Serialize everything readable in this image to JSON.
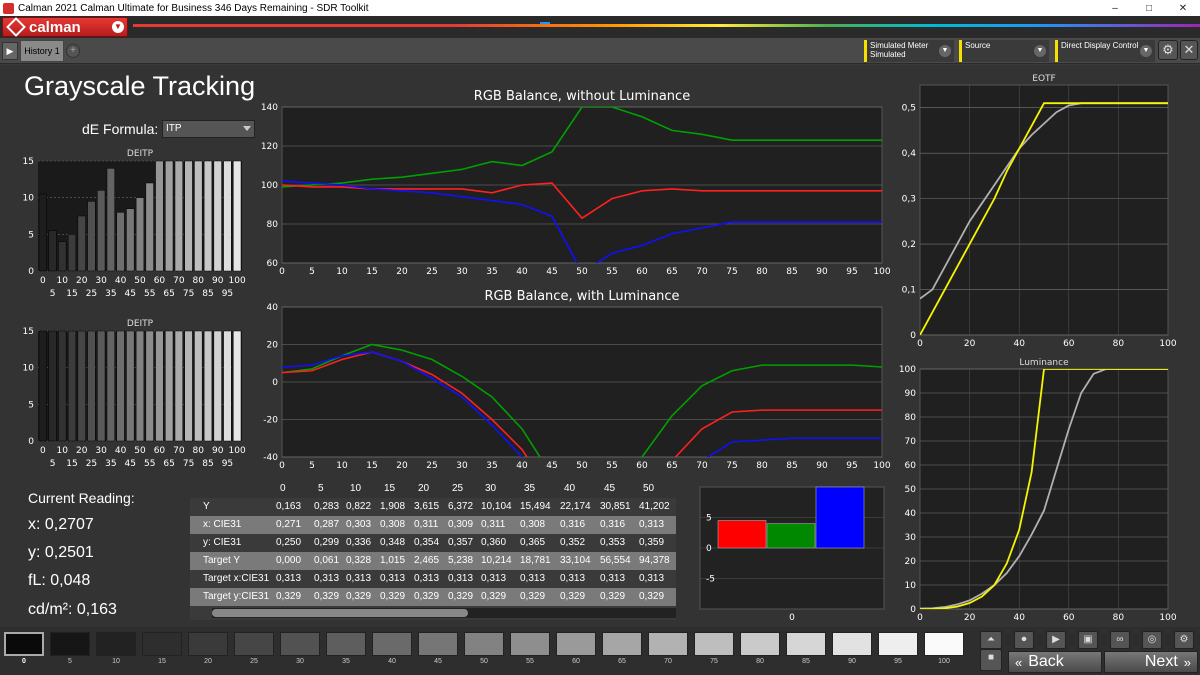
{
  "window": {
    "title": "Calman 2021 Calman Ultimate for Business 346 Days Remaining  - SDR Toolkit",
    "minimize": "–",
    "maximize": "□",
    "close": "✕"
  },
  "brand": {
    "logo_text": "calman"
  },
  "tabs": {
    "history": "History 1",
    "add": "+"
  },
  "dropdowns": {
    "meter_label": "Simulated Meter",
    "meter_value": "Simulated",
    "source_label": "Source",
    "display_label": "Direct Display Control"
  },
  "page": {
    "title": "Grayscale Tracking",
    "de_formula_label": "dE Formula:",
    "de_formula_value": "ITP"
  },
  "current_reading": {
    "heading": "Current Reading:",
    "x": "x: 0,2707",
    "y": "y: 0,2501",
    "fl": "fL: 0,048",
    "cdm2": "cd/m²: 0,163"
  },
  "table": {
    "columns": [
      "0",
      "5",
      "10",
      "15",
      "20",
      "25",
      "30",
      "35",
      "40",
      "45",
      "50"
    ],
    "rows": [
      {
        "label": "Y",
        "values": [
          "0,163",
          "0,283",
          "0,822",
          "1,908",
          "3,615",
          "6,372",
          "10,104",
          "15,494",
          "22,174",
          "30,851",
          "41,202"
        ]
      },
      {
        "label": "x: CIE31",
        "values": [
          "0,271",
          "0,287",
          "0,303",
          "0,308",
          "0,311",
          "0,309",
          "0,311",
          "0,308",
          "0,316",
          "0,316",
          "0,313"
        ]
      },
      {
        "label": "y: CIE31",
        "values": [
          "0,250",
          "0,299",
          "0,336",
          "0,348",
          "0,354",
          "0,357",
          "0,360",
          "0,365",
          "0,352",
          "0,353",
          "0,359"
        ]
      },
      {
        "label": "Target Y",
        "values": [
          "0,000",
          "0,061",
          "0,328",
          "1,015",
          "2,465",
          "5,238",
          "10,214",
          "18,781",
          "33,104",
          "56,554",
          "94,378"
        ]
      },
      {
        "label": "Target x:CIE31",
        "values": [
          "0,313",
          "0,313",
          "0,313",
          "0,313",
          "0,313",
          "0,313",
          "0,313",
          "0,313",
          "0,313",
          "0,313",
          "0,313"
        ]
      },
      {
        "label": "Target y:CIE31",
        "values": [
          "0,329",
          "0,329",
          "0,329",
          "0,329",
          "0,329",
          "0,329",
          "0,329",
          "0,329",
          "0,329",
          "0,329",
          "0,329"
        ]
      }
    ]
  },
  "patches": {
    "labels": [
      "0",
      "5",
      "10",
      "15",
      "20",
      "25",
      "30",
      "35",
      "40",
      "45",
      "50",
      "55",
      "60",
      "65",
      "70",
      "75",
      "80",
      "85",
      "90",
      "95",
      "100"
    ]
  },
  "nav": {
    "back": "Back",
    "next": "Next"
  },
  "colors": {
    "accent_yellow": "#f5e000",
    "brand_red": "#d32f2f"
  },
  "chart_data": [
    {
      "type": "bar",
      "title": "DEITP",
      "categories": [
        "0",
        "5",
        "10",
        "15",
        "20",
        "25",
        "30",
        "35",
        "40",
        "45",
        "50",
        "55",
        "60",
        "65",
        "70",
        "75",
        "80",
        "85",
        "90",
        "95",
        "100"
      ],
      "values": [
        10.5,
        5.5,
        4,
        5,
        7.5,
        9.5,
        11,
        14,
        8,
        8.5,
        10,
        12,
        15,
        15,
        15,
        15,
        15,
        15,
        15,
        15,
        15
      ],
      "ylim": [
        0,
        15
      ],
      "yticks": [
        0,
        5,
        10,
        15
      ],
      "xticks_row1": [
        "0",
        "10",
        "20",
        "30",
        "40",
        "50",
        "60",
        "70",
        "80",
        "90",
        "100"
      ],
      "xticks_row2": [
        "5",
        "15",
        "25",
        "35",
        "45",
        "55",
        "65",
        "75",
        "85",
        "95"
      ]
    },
    {
      "type": "bar",
      "title": "DEITP",
      "categories": [
        "0",
        "5",
        "10",
        "15",
        "20",
        "25",
        "30",
        "35",
        "40",
        "45",
        "50",
        "55",
        "60",
        "65",
        "70",
        "75",
        "80",
        "85",
        "90",
        "95",
        "100"
      ],
      "values": [
        15,
        15,
        15,
        15,
        15,
        15,
        15,
        15,
        15,
        15,
        15,
        15,
        15,
        15,
        15,
        15,
        15,
        15,
        15,
        15,
        15
      ],
      "ylim": [
        0,
        15
      ],
      "yticks": [
        0,
        5,
        10,
        15
      ],
      "xticks_row1": [
        "0",
        "10",
        "20",
        "30",
        "40",
        "50",
        "60",
        "70",
        "80",
        "90",
        "100"
      ],
      "xticks_row2": [
        "5",
        "15",
        "25",
        "35",
        "45",
        "55",
        "65",
        "75",
        "85",
        "95"
      ]
    },
    {
      "type": "line",
      "title": "RGB Balance, without Luminance",
      "x": [
        0,
        5,
        10,
        15,
        20,
        25,
        30,
        35,
        40,
        45,
        50,
        55,
        60,
        65,
        70,
        75,
        80,
        85,
        90,
        95,
        100
      ],
      "ylim": [
        60,
        140
      ],
      "yticks": [
        60,
        80,
        100,
        120,
        140
      ],
      "xticks": [
        0,
        5,
        10,
        15,
        20,
        25,
        30,
        35,
        40,
        45,
        50,
        55,
        60,
        65,
        70,
        75,
        80,
        85,
        90,
        95,
        100
      ],
      "series": [
        {
          "color": "#00a000",
          "values": [
            99,
            100,
            101,
            103,
            104,
            106,
            108,
            112,
            110,
            117,
            140,
            140,
            135,
            128,
            126,
            123,
            123,
            123,
            123,
            123,
            123
          ]
        },
        {
          "color": "#ff2020",
          "values": [
            100,
            99,
            99,
            98,
            98,
            98,
            98,
            96,
            100,
            101,
            83,
            93,
            97,
            98,
            97,
            97,
            97,
            97,
            97,
            97,
            97
          ]
        },
        {
          "color": "#1010ff",
          "values": [
            102,
            101,
            100,
            98,
            97,
            96,
            94,
            92,
            90,
            84,
            55,
            65,
            69,
            75,
            78,
            81,
            81,
            81,
            81,
            81,
            81
          ]
        }
      ]
    },
    {
      "type": "line",
      "title": "RGB Balance, with Luminance",
      "x": [
        0,
        5,
        10,
        15,
        20,
        25,
        30,
        35,
        40,
        45,
        50,
        55,
        60,
        65,
        70,
        75,
        80,
        85,
        90,
        95,
        100
      ],
      "ylim": [
        -40,
        40
      ],
      "yticks": [
        -40,
        -20,
        0,
        20,
        40
      ],
      "xticks": [
        0,
        5,
        10,
        15,
        20,
        25,
        30,
        35,
        40,
        45,
        50,
        55,
        60,
        65,
        70,
        75,
        80,
        85,
        90,
        95,
        100
      ],
      "series": [
        {
          "color": "#00a000",
          "values": [
            5,
            7,
            14,
            20,
            17,
            12,
            3,
            -8,
            -25,
            -50,
            -60,
            -60,
            -40,
            -18,
            -2,
            6,
            9,
            9,
            9,
            9,
            8
          ]
        },
        {
          "color": "#ff2020",
          "values": [
            5,
            6,
            12,
            16,
            11,
            4,
            -6,
            -20,
            -36,
            -60,
            -60,
            -60,
            -60,
            -42,
            -25,
            -16,
            -15,
            -15,
            -15,
            -15,
            -15
          ]
        },
        {
          "color": "#1010ff",
          "values": [
            8,
            9,
            14,
            16,
            11,
            2,
            -8,
            -23,
            -40,
            -60,
            -60,
            -60,
            -60,
            -60,
            -42,
            -32,
            -31,
            -30,
            -30,
            -30,
            -30
          ]
        }
      ]
    },
    {
      "type": "bar",
      "title": "",
      "categories": [
        "R",
        "G",
        "B"
      ],
      "values": [
        4.5,
        4,
        10
      ],
      "colors": [
        "#ff0000",
        "#008800",
        "#0000ff"
      ],
      "ylim": [
        -10,
        10
      ],
      "yticks": [
        -5,
        0,
        5
      ],
      "xticks": [
        "0"
      ]
    },
    {
      "type": "line",
      "title": "EOTF",
      "x": [
        0,
        5,
        10,
        15,
        20,
        25,
        30,
        35,
        40,
        45,
        50,
        55,
        60,
        65,
        70,
        75,
        80,
        85,
        90,
        95,
        100
      ],
      "ylim": [
        0,
        0.55
      ],
      "yticks": [
        "0",
        "0,1",
        "0,2",
        "0,3",
        "0,4",
        "0,5"
      ],
      "ytick_values": [
        0,
        0.1,
        0.2,
        0.3,
        0.4,
        0.5
      ],
      "xticks": [
        0,
        20,
        40,
        60,
        80,
        100
      ],
      "series": [
        {
          "color": "#b0b0b0",
          "values": [
            0.08,
            0.1,
            0.15,
            0.2,
            0.25,
            0.29,
            0.33,
            0.37,
            0.41,
            0.44,
            0.465,
            0.49,
            0.505,
            0.51,
            0.51,
            0.51,
            0.51,
            0.51,
            0.51,
            0.51,
            0.51
          ]
        },
        {
          "color": "#f5f500",
          "values": [
            0,
            0.05,
            0.1,
            0.15,
            0.2,
            0.25,
            0.3,
            0.36,
            0.41,
            0.46,
            0.51,
            0.51,
            0.51,
            0.51,
            0.51,
            0.51,
            0.51,
            0.51,
            0.51,
            0.51,
            0.51
          ]
        }
      ]
    },
    {
      "type": "line",
      "title": "Luminance",
      "x": [
        0,
        5,
        10,
        15,
        20,
        25,
        30,
        35,
        40,
        45,
        50,
        55,
        60,
        65,
        70,
        75,
        80,
        85,
        90,
        95,
        100
      ],
      "ylim": [
        0,
        100
      ],
      "yticks": [
        0,
        10,
        20,
        30,
        40,
        50,
        60,
        70,
        80,
        90,
        100
      ],
      "xticks": [
        0,
        20,
        40,
        60,
        80,
        100
      ],
      "series": [
        {
          "color": "#b0b0b0",
          "values": [
            0.2,
            0.3,
            0.8,
            1.9,
            3.6,
            6.4,
            10,
            15,
            22,
            31,
            41,
            58,
            75,
            90,
            98,
            100,
            100,
            100,
            100,
            100,
            100
          ]
        },
        {
          "color": "#f5f500",
          "values": [
            0,
            0.06,
            0.3,
            1,
            2.5,
            5.2,
            10,
            19,
            33,
            57,
            100,
            100,
            100,
            100,
            100,
            100,
            100,
            100,
            100,
            100,
            100
          ]
        }
      ]
    }
  ]
}
